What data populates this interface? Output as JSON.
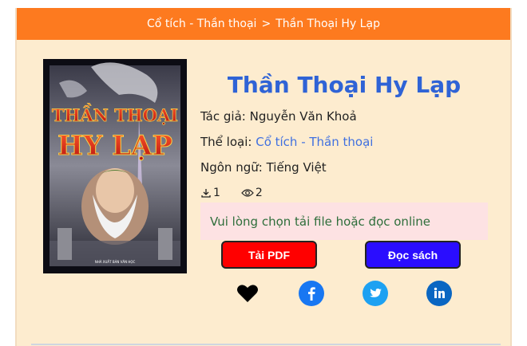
{
  "breadcrumb": {
    "category": "Cổ tích - Thần thoại",
    "separator": ">",
    "current": "Thần Thoại Hy Lạp"
  },
  "book": {
    "title": "Thần Thoại Hy Lạp",
    "cover_line1": "THẦN THOẠI",
    "cover_line2": "HY LẠP",
    "cover_publisher": "NHÀ XUẤT BẢN VĂN HỌC",
    "author_label": "Tác giả:",
    "author": "Nguyễn Văn Khoả",
    "genre_label": "Thể loại:",
    "genre": "Cổ tích - Thần thoại",
    "language_label": "Ngôn ngữ:",
    "language": "Tiếng Việt",
    "downloads": "1",
    "views": "2"
  },
  "notice": "Vui lòng chọn tải file hoặc đọc online",
  "buttons": {
    "pdf": "Tải PDF",
    "read": "Đọc sách"
  },
  "share": {
    "facebook_color": "#1877f2",
    "twitter_color": "#1da1f2",
    "linkedin_color": "#0a66c2"
  }
}
